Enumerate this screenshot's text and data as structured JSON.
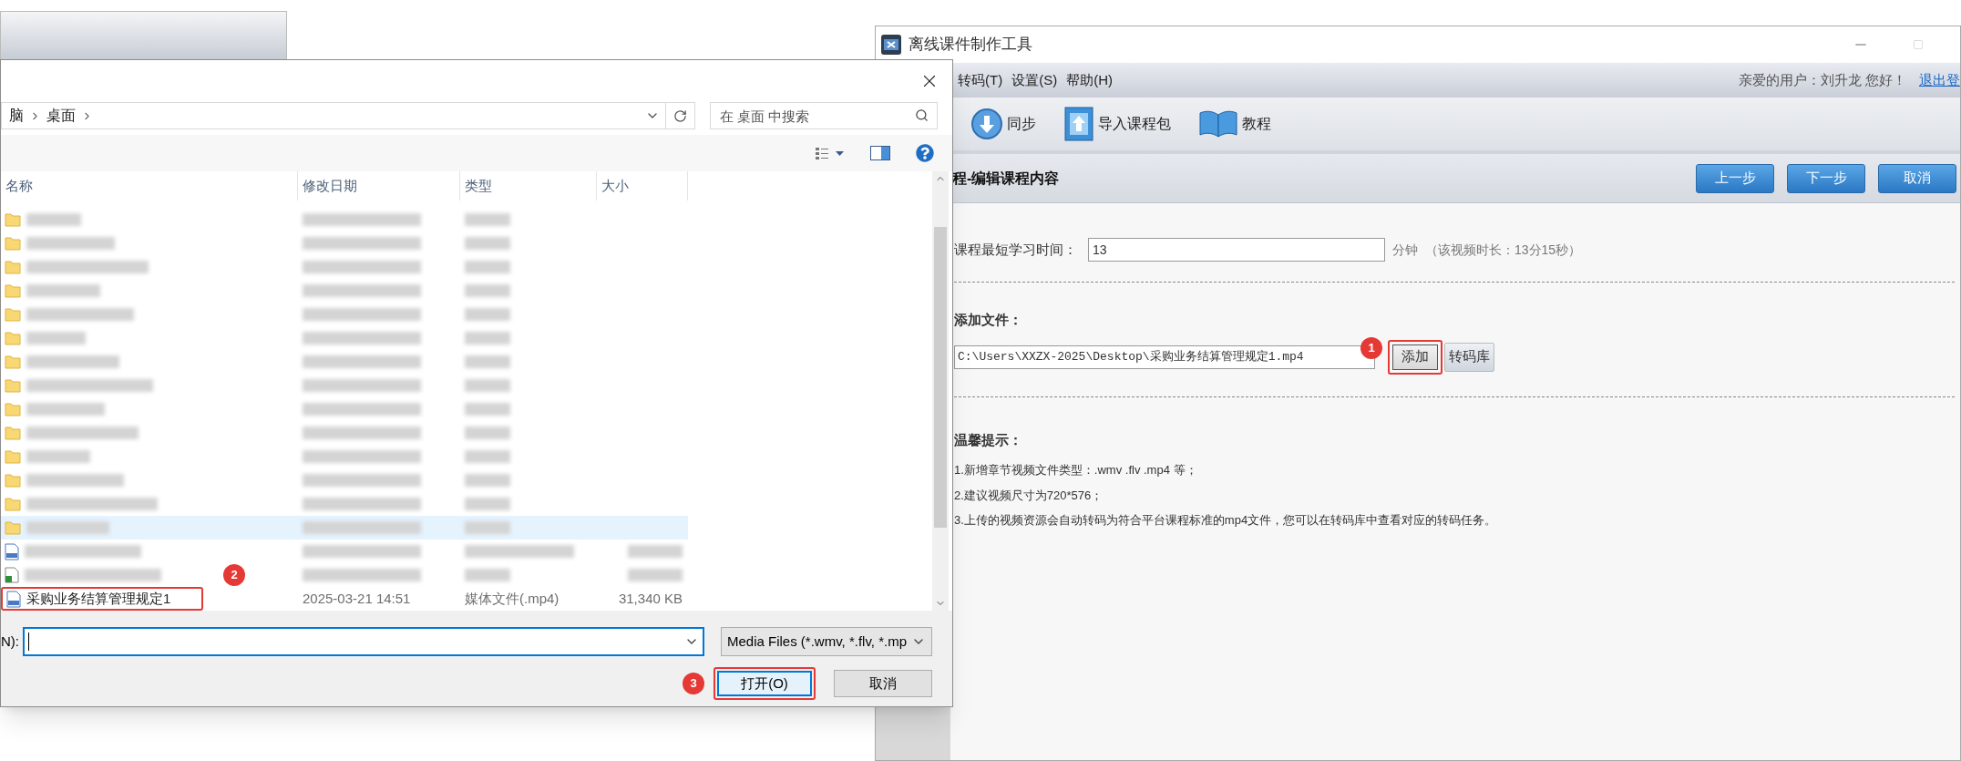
{
  "app_window": {
    "title": "离线课件制作工具",
    "menu": [
      "转码(T)",
      "设置(S)",
      "帮助(H)"
    ],
    "greeting": "亲爱的用户：刘升龙 您好！",
    "logout_link": "退出登",
    "toolbar": [
      {
        "label": "同步",
        "kind": "sync"
      },
      {
        "label": "导入课程包",
        "kind": "import"
      },
      {
        "label": "教程",
        "kind": "book"
      }
    ],
    "step_title": "程-编辑课程内容",
    "nav_buttons": [
      "上一步",
      "下一步",
      "取消"
    ],
    "min_time_label": "课程最短学习时间：",
    "min_time_value": "13",
    "min_time_unit": "分钟",
    "duration_note": "（该视频时长：13分15秒）",
    "add_file_label": "添加文件：",
    "file_path": "C:\\Users\\XXZX-2025\\Desktop\\采购业务结算管理规定1.mp4",
    "add_button": "添加",
    "add_callout": "1",
    "transcode_button": "转码库",
    "tips_title": "温馨提示：",
    "tips": [
      "1.新增章节视频文件类型：.wmv .flv .mp4 等；",
      "2.建议视频尺寸为720*576；",
      "3.上传的视频资源会自动转码为符合平台课程标准的mp4文件，您可以在转码库中查看对应的转码任务。"
    ]
  },
  "dialog": {
    "breadcrumb": [
      "脑",
      "桌面"
    ],
    "search_placeholder": "在 桌面 中搜索",
    "columns": [
      "名称",
      "修改日期",
      "类型",
      "大小"
    ],
    "rows": [
      {
        "kind": "folder",
        "selected": false
      },
      {
        "kind": "folder",
        "selected": false
      },
      {
        "kind": "folder",
        "selected": false
      },
      {
        "kind": "folder",
        "selected": false
      },
      {
        "kind": "folder",
        "selected": false
      },
      {
        "kind": "folder",
        "selected": false
      },
      {
        "kind": "folder",
        "selected": false
      },
      {
        "kind": "folder",
        "selected": false
      },
      {
        "kind": "folder",
        "selected": false
      },
      {
        "kind": "folder",
        "selected": false
      },
      {
        "kind": "folder",
        "selected": false
      },
      {
        "kind": "folder",
        "selected": false
      },
      {
        "kind": "folder",
        "selected": false
      },
      {
        "kind": "folder",
        "selected": true
      },
      {
        "kind": "video",
        "selected": false
      },
      {
        "kind": "shortcut",
        "selected": false
      },
      {
        "kind": "video",
        "selected": false,
        "name": "采购业务结算管理规定1",
        "date": "2025-03-21 14:51",
        "type": "媒体文件(.mp4)",
        "size": "31,340 KB"
      }
    ],
    "file_callout": "2",
    "filename_label": "N):",
    "filetype": "Media Files (*.wmv, *.flv, *.mp",
    "open_button": "打开(O)",
    "open_callout": "3",
    "cancel_button": "取消"
  }
}
